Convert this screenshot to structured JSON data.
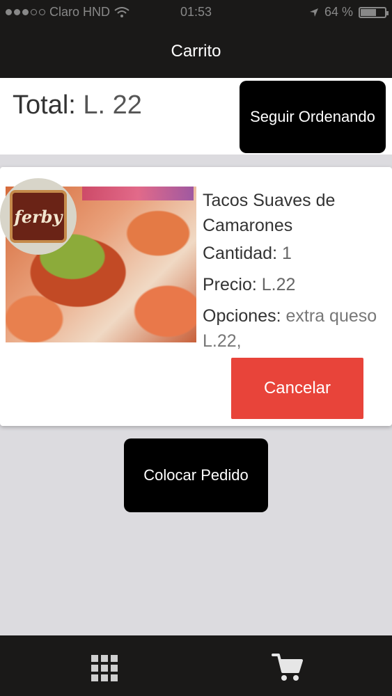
{
  "status_bar": {
    "carrier": "Claro HND",
    "time": "01:53",
    "battery": "64 %",
    "battery_level": 0.64,
    "icons": [
      "signal-dots-icon",
      "wifi-icon",
      "location-arrow-icon",
      "battery-icon"
    ]
  },
  "nav": {
    "title": "Carrito"
  },
  "total": {
    "label": "Total:",
    "amount": "L. 22"
  },
  "buttons": {
    "seguir": "Seguir Ordenando",
    "cancelar": "Cancelar",
    "colocar": "Colocar Pedido"
  },
  "cart_item": {
    "logo_text": "ferby",
    "name": "Tacos Suaves de Camarones",
    "cantidad_label": "Cantidad:",
    "cantidad": "1",
    "precio_label": "Precio:",
    "precio": "L.22",
    "opciones_label": "Opciones:",
    "opciones": "extra queso L.22,"
  },
  "tabbar": {
    "icons": [
      "grid-menu-icon",
      "shopping-cart-icon"
    ]
  },
  "colors": {
    "bar": "#1a1918",
    "cancel": "#e8443a",
    "background": "#dcdbdf"
  }
}
